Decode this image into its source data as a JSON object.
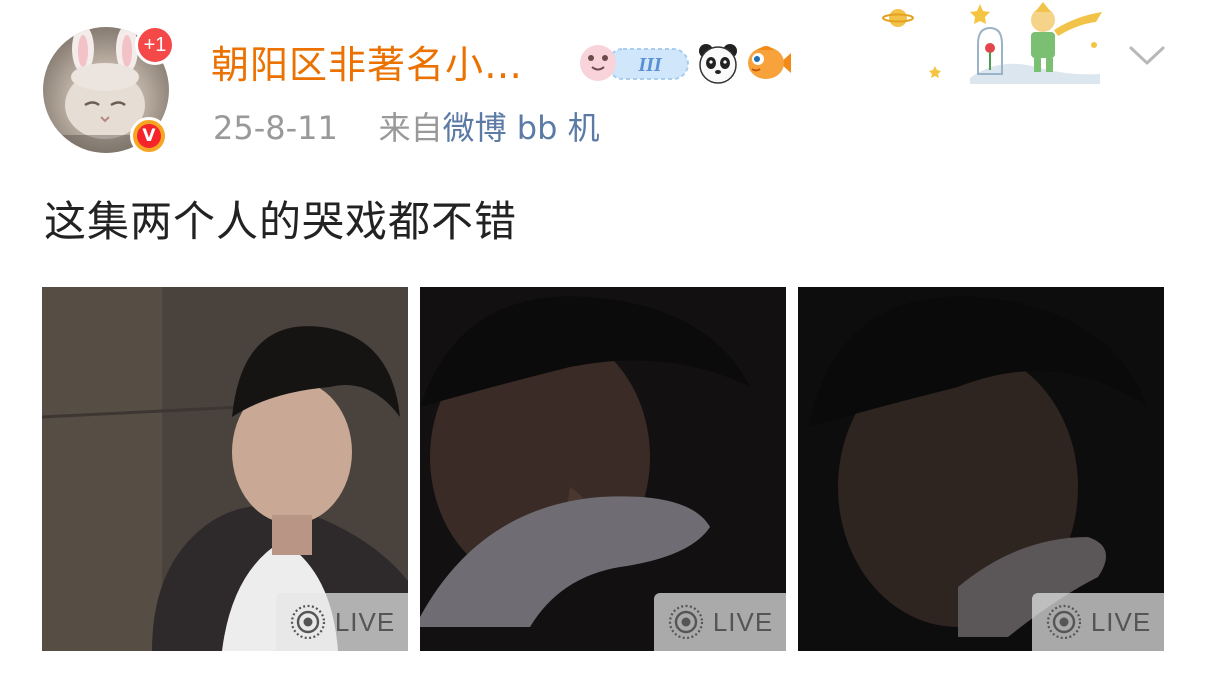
{
  "header": {
    "username": "朝阳区非著名小…",
    "notification_count": "+1",
    "verify_mark": "V",
    "badge_level": "III",
    "date": "25-8-11",
    "source_prefix": "来自",
    "source_name": "微博 bb 机"
  },
  "post": {
    "text": "这集两个人的哭戏都不错"
  },
  "photos": [
    {
      "live_label": "LIVE"
    },
    {
      "live_label": "LIVE"
    },
    {
      "live_label": "LIVE"
    }
  ],
  "icons": {
    "expand": "chevron-down-icon",
    "live": "live-photo-icon",
    "panda": "panda-emoji-icon",
    "fish": "fish-emoji-icon"
  },
  "colors": {
    "username": "#eb7100",
    "source_link": "#5c7aa6",
    "count_badge": "#f54848"
  }
}
